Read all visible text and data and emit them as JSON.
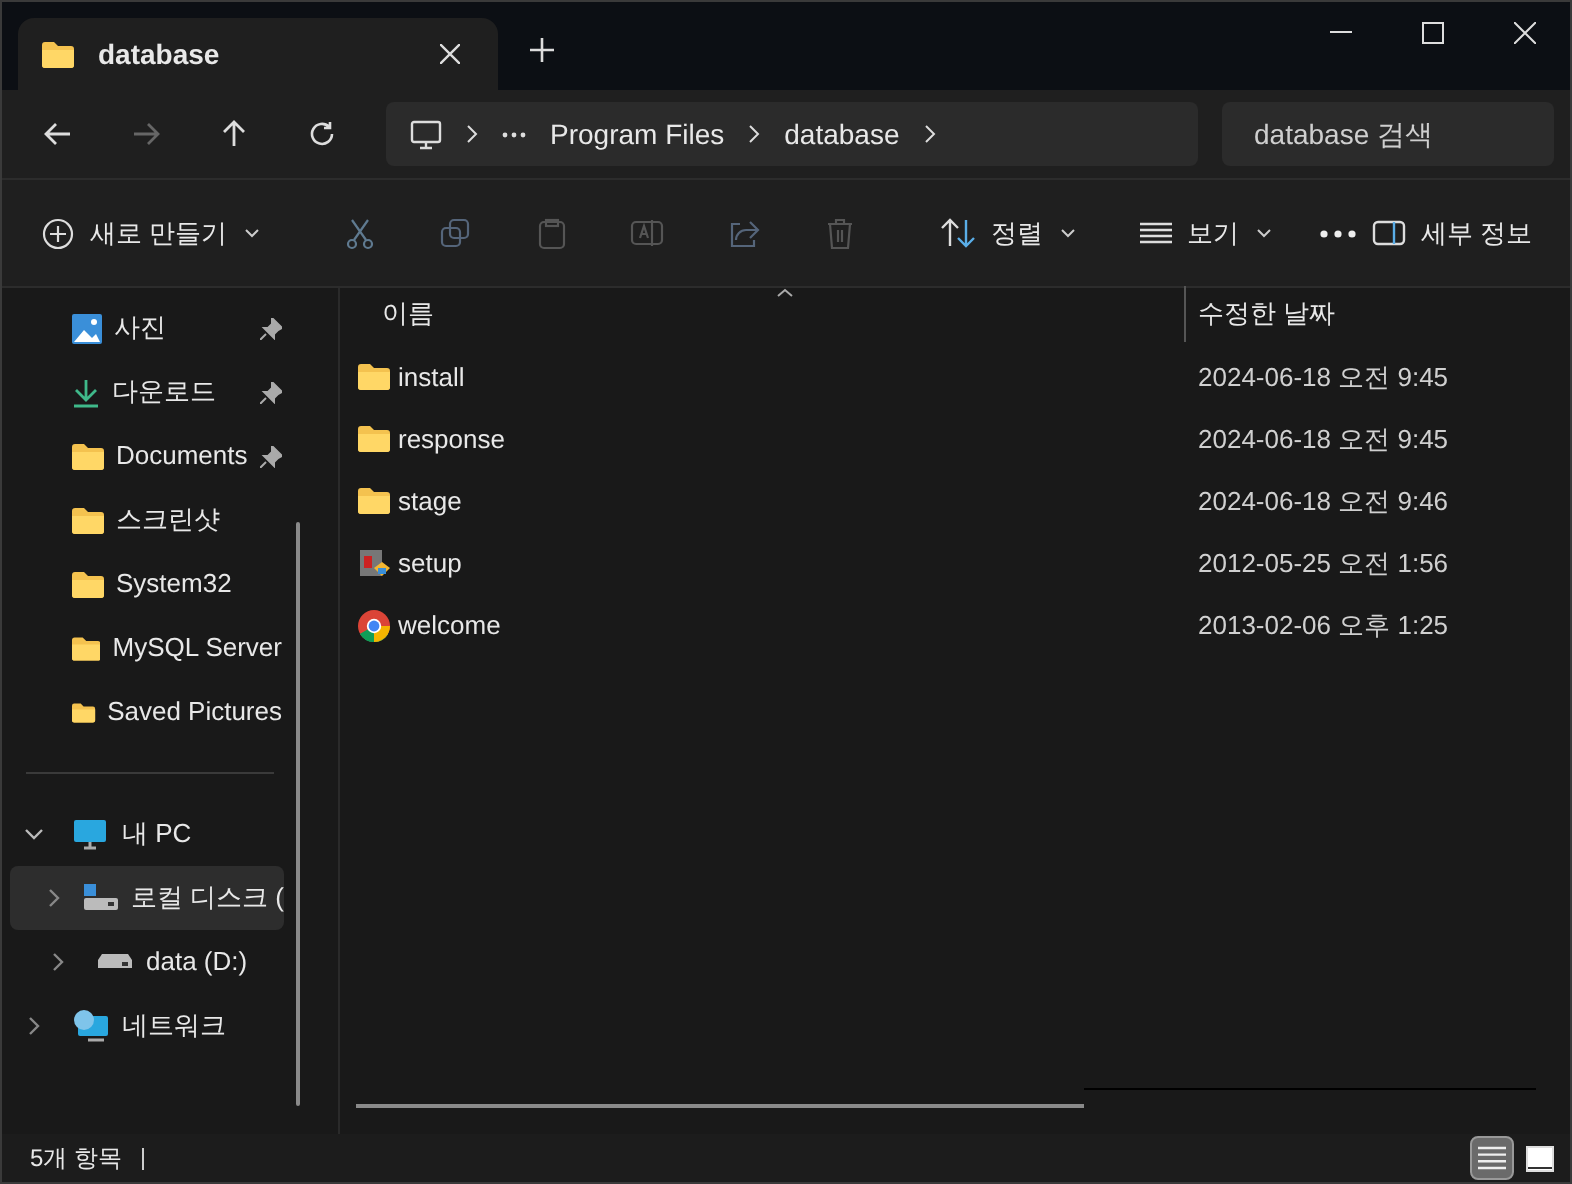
{
  "tabs": [
    {
      "title": "database",
      "selected": true
    }
  ],
  "breadcrumb": [
    "Program Files",
    "database"
  ],
  "search": {
    "placeholder": "database 검색"
  },
  "commands": {
    "new": "새로 만들기",
    "sort": "정렬",
    "view": "보기",
    "details": "세부 정보"
  },
  "quick_access": [
    {
      "label": "사진",
      "kind": "pictures",
      "pinned": true
    },
    {
      "label": "다운로드",
      "kind": "downloads",
      "pinned": true
    },
    {
      "label": "Documents",
      "kind": "folder",
      "pinned": true
    },
    {
      "label": "스크린샷",
      "kind": "folder",
      "pinned": false
    },
    {
      "label": "System32",
      "kind": "folder",
      "pinned": false
    },
    {
      "label": "MySQL Server",
      "kind": "folder",
      "pinned": false
    },
    {
      "label": "Saved Pictures",
      "kind": "folder",
      "pinned": false
    }
  ],
  "tree": [
    {
      "label": "내 PC",
      "kind": "pc",
      "expanded": true,
      "selected": false,
      "children": [
        {
          "label": "로컬 디스크 (",
          "kind": "system-drive",
          "expanded": false,
          "selected": true
        },
        {
          "label": "data (D:)",
          "kind": "drive",
          "expanded": false,
          "selected": false
        }
      ]
    },
    {
      "label": "네트워크",
      "kind": "network",
      "expanded": false,
      "selected": false
    }
  ],
  "table": {
    "columns": [
      "이름",
      "수정한 날짜"
    ],
    "rows": [
      {
        "name": "install",
        "kind": "folder",
        "modified": "2024-06-18 오전 9:45"
      },
      {
        "name": "response",
        "kind": "folder",
        "modified": "2024-06-18 오전 9:45"
      },
      {
        "name": "stage",
        "kind": "folder",
        "modified": "2024-06-18 오전 9:46"
      },
      {
        "name": "setup",
        "kind": "installer",
        "modified": "2012-05-25 오전 1:56"
      },
      {
        "name": "welcome",
        "kind": "chrome",
        "modified": "2013-02-06 오후 1:25"
      }
    ]
  },
  "status_bar": {
    "count": "5개 항목",
    "views": [
      {
        "kind": "details",
        "selected": true
      },
      {
        "kind": "tiles",
        "selected": false
      }
    ]
  }
}
